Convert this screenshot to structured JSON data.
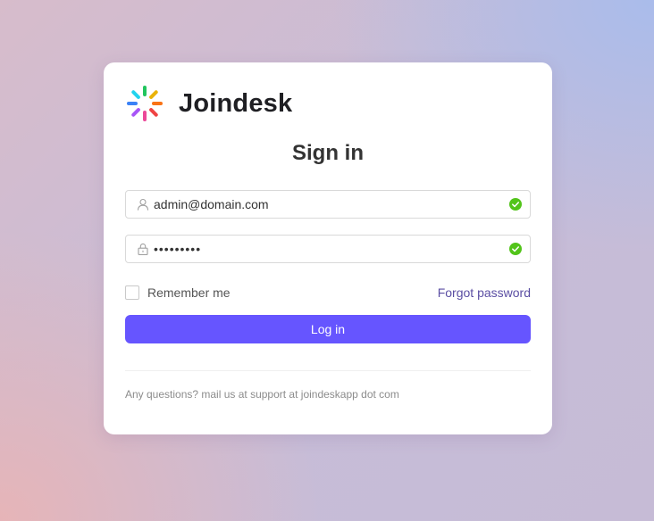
{
  "brand": {
    "name": "Joindesk",
    "logo_icon": "sunburst-logo-icon",
    "logo_colors": [
      "#22c55e",
      "#eab308",
      "#f97316",
      "#ef4444",
      "#ec4899",
      "#a855f7",
      "#3b82f6",
      "#22d3ee"
    ]
  },
  "form": {
    "title": "Sign in",
    "email": {
      "value": "admin@domain.com",
      "prefix_icon": "user-icon",
      "status_icon": "check-circle-icon"
    },
    "password": {
      "value": "•••••••••",
      "prefix_icon": "lock-icon",
      "status_icon": "check-circle-icon"
    },
    "remember_label": "Remember me",
    "remember_checked": false,
    "forgot_label": "Forgot password",
    "login_label": "Log in"
  },
  "footer": {
    "note": "Any questions? mail us at support at joindeskapp dot com"
  },
  "colors": {
    "accent": "#6655ff",
    "link": "#5b4ea3",
    "success": "#52c41a"
  }
}
